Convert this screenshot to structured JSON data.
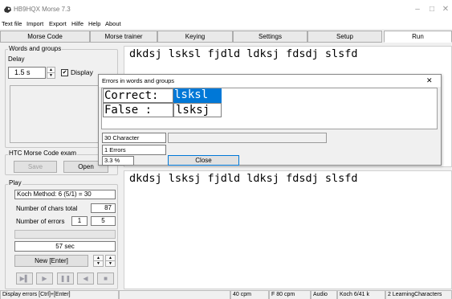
{
  "window": {
    "title": "HB9HQX Morse 7.3",
    "minimize": "–",
    "maximize": "□",
    "close": "✕"
  },
  "menu": [
    "Text file",
    "Import",
    "Export",
    "Hilfe",
    "Help",
    "About"
  ],
  "tabs": [
    {
      "label": "Morse Code",
      "active": false
    },
    {
      "label": "Morse trainer",
      "active": false
    },
    {
      "label": "Keying",
      "active": false
    },
    {
      "label": "Settings",
      "active": false
    },
    {
      "label": "Setup",
      "active": false
    },
    {
      "label": "Run",
      "active": true
    }
  ],
  "words_group": {
    "legend": "Words and groups",
    "delay_label": "Delay",
    "delay_value": "1.5 s",
    "display_label": "Display",
    "display_checked": "✔"
  },
  "htc_group": {
    "legend": "HTC Morse Code exam",
    "save_label": "Save",
    "open_label": "Open"
  },
  "play_group": {
    "legend": "Play",
    "koch_method": "Koch Method: 6 (5/1) = 30",
    "chars_total_label": "Number of chars total",
    "chars_total_value": "87",
    "errors_label": "Number of errors",
    "errors_value_1": "1",
    "errors_value_2": "5",
    "timer": "57 sec",
    "new_button": "New  [Enter]"
  },
  "text_top": "dkdsj lsksl fjdld ldksj fdsdj slsfd",
  "text_bottom": "dkdsj lsksj fjdld ldksj fdsdj slsfd",
  "dialog": {
    "title": "Errors in words and groups",
    "close_icon": "✕",
    "correct_label": "Correct:",
    "correct_value": "lsksl",
    "false_label": "False  :",
    "false_value": "lsksj",
    "stat_chars": "30 Character",
    "stat_errors": "1 Errors",
    "stat_percent": "3.3 %",
    "close_button": "Close"
  },
  "statusbar": {
    "hint": "Display errors  [Ctrl]+[Enter]",
    "cpm": "40 cpm",
    "f_cpm": "F 80 cpm",
    "audio": "Audio",
    "koch": "Koch 6/41  k",
    "learning": "2 LearningCharacters"
  },
  "colors": {
    "accent": "#0078d7",
    "selection_text": "#ffffff"
  }
}
